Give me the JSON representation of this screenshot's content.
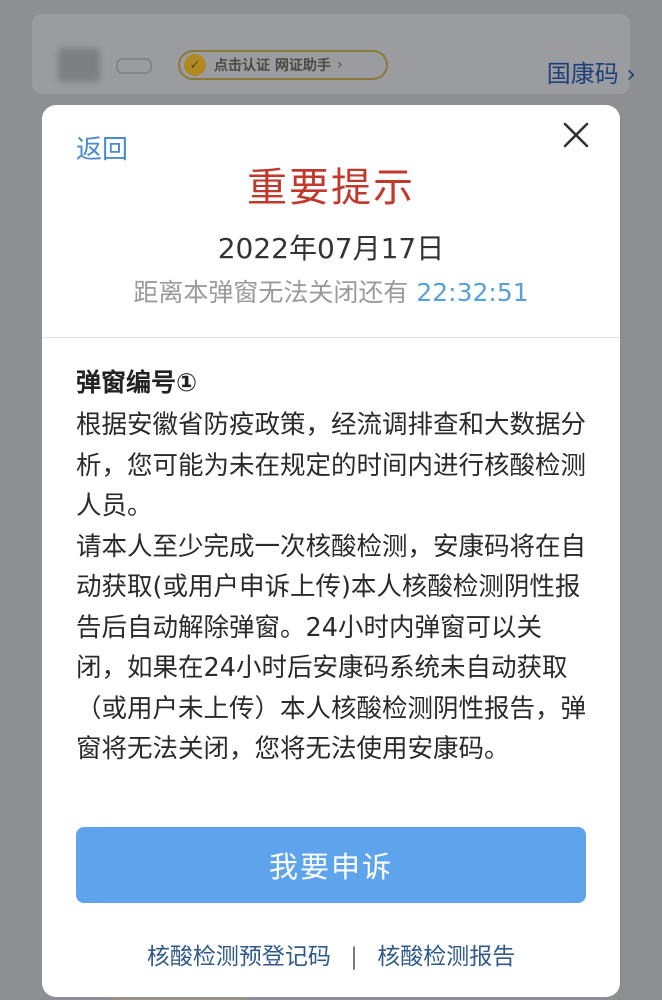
{
  "background": {
    "badge_label": "点击认证 网证助手",
    "badge_icon": "badge-v-icon",
    "health_code_link": "国康码"
  },
  "modal": {
    "back_label": "返回",
    "close_icon": "close-icon",
    "title": "重要提示",
    "date": "2022年07月17日",
    "countdown_prefix": "距离本弹窗无法关闭还有",
    "countdown_time": "22:32:51",
    "section_heading": "弹窗编号①",
    "paragraph_1": "根据安徽省防疫政策，经流调排查和大数据分析，您可能为未在规定的时间内进行核酸检测人员。",
    "paragraph_2": "请本人至少完成一次核酸检测，安康码将在自动获取(或用户申诉上传)本人核酸检测阴性报告后自动解除弹窗。24小时内弹窗可以关闭，如果在24小时后安康码系统未自动获取（或用户未上传）本人核酸检测阴性报告，弹窗将无法关闭，您将无法使用安康码。",
    "appeal_button": "我要申诉",
    "footer_link_1": "核酸检测预登记码",
    "footer_separator": "|",
    "footer_link_2": "核酸检测报告"
  },
  "colors": {
    "title_red": "#c1392b",
    "accent_blue": "#5ea4ec",
    "timer_blue": "#5aa0d8",
    "overlay_gray": "#8d8f93"
  }
}
